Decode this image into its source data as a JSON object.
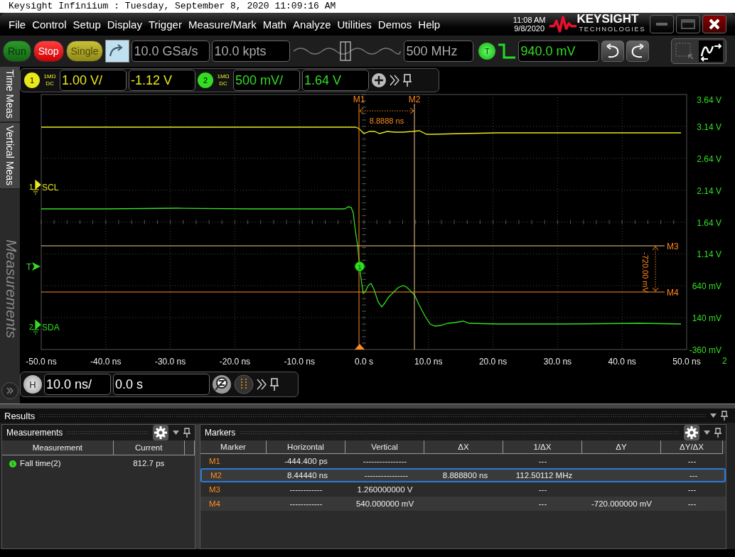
{
  "title_bar": {
    "title": "Keysight Infiniium : Tuesday, September 8, 2020 11:09:16 AM"
  },
  "menu": [
    "File",
    "Control",
    "Setup",
    "Display",
    "Trigger",
    "Measure/Mark",
    "Math",
    "Analyze",
    "Utilities",
    "Demos",
    "Help"
  ],
  "clock": {
    "time": "11:08 AM",
    "date": "9/8/2020"
  },
  "logo": {
    "name": "KEYSIGHT",
    "sub": "TECHNOLOGIES"
  },
  "toolbar": {
    "acquisition": [
      {
        "label": "Run",
        "kind": "run"
      },
      {
        "label": "Stop",
        "kind": "stop"
      },
      {
        "label": "Single",
        "kind": "single"
      }
    ],
    "sample_rate": "10.0 GSa/s",
    "memory_depth": "10.0 kpts",
    "bandwidth": "500 MHz",
    "trigger": {
      "badge": "T",
      "level": "940.0 mV"
    }
  },
  "side_tabs": [
    {
      "label": "Time Meas"
    },
    {
      "label": "Vertical Meas"
    }
  ],
  "side_panel_title": "Measurements",
  "channels": [
    {
      "badge": "1",
      "impedance": "1MΩ",
      "coupling": "DC",
      "scale": "1.00 V/",
      "offset": "-1.12 V",
      "color": "#e8e81a"
    },
    {
      "badge": "2",
      "impedance": "1MΩ",
      "coupling": "DC",
      "scale": "500 mV/",
      "offset": "1.64 V",
      "color": "#33dd22"
    }
  ],
  "plot": {
    "y_labels": [
      "3.64 V",
      "3.14 V",
      "2.64 V",
      "2.14 V",
      "1.64 V",
      "1.14 V",
      "640 mV",
      "140 mV",
      "-360 mV"
    ],
    "x_labels": [
      "-50.0 ns",
      "-40.0 ns",
      "-30.0 ns",
      "-20.0 ns",
      "-10.0 ns",
      "0.0 s",
      "10.0 ns",
      "20.0 ns",
      "30.0 ns",
      "40.0 ns",
      "50.0 ns"
    ],
    "y_axis_channel": "2",
    "traces": [
      {
        "badge": "1",
        "name": "SCL",
        "color": "#e8e81a"
      },
      {
        "badge": "2",
        "name": "SDA",
        "color": "#33dd22"
      }
    ],
    "trigger_label": "T",
    "markers": [
      {
        "label": "M1",
        "kind": "vertical"
      },
      {
        "label": "M2",
        "kind": "vertical"
      },
      {
        "label": "M3",
        "kind": "horizontal"
      },
      {
        "label": "M4",
        "kind": "horizontal"
      }
    ],
    "delta_x": "8.8888 ns",
    "delta_y": "-720.00 mV",
    "measure_point": "1"
  },
  "horizontal": {
    "badge": "H",
    "scale": "10.0 ns/",
    "position": "0.0 s"
  },
  "results": {
    "title": "Results",
    "measurements": {
      "title": "Measurements",
      "columns": [
        "Measurement",
        "Current"
      ],
      "rows": [
        {
          "badge": "1",
          "name": "Fall time(2)",
          "value": "812.7 ps"
        }
      ]
    },
    "markers": {
      "title": "Markers",
      "columns": [
        "Marker",
        "Horizontal",
        "Vertical",
        "ΔX",
        "1/ΔX",
        "ΔY",
        "ΔY/ΔX"
      ],
      "rows": [
        {
          "selected": false,
          "cells": [
            "M1",
            "-444.400 ps",
            "----------------",
            null,
            "---",
            null,
            "---"
          ]
        },
        {
          "selected": true,
          "cells": [
            "M2",
            "8.44440 ns",
            "----------------",
            "8.888800 ns",
            "112.50112 MHz",
            null,
            "---"
          ]
        },
        {
          "selected": false,
          "cells": [
            "M3",
            "------------",
            "1.260000000 V",
            null,
            "---",
            null,
            "---"
          ]
        },
        {
          "selected": false,
          "cells": [
            "M4",
            "------------",
            "540.000000 mV",
            null,
            "---",
            "-720.000000 mV",
            "---"
          ]
        }
      ]
    }
  }
}
